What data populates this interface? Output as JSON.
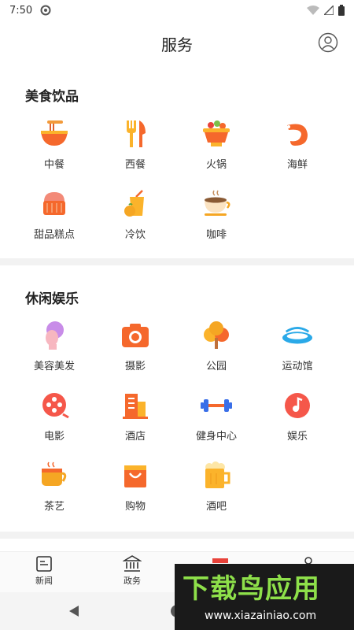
{
  "status": {
    "time": "7:50"
  },
  "header": {
    "title": "服务"
  },
  "sections": [
    {
      "title": "美食饮品",
      "items": [
        {
          "label": "中餐",
          "icon": "noodle-bowl-icon"
        },
        {
          "label": "西餐",
          "icon": "fork-knife-icon"
        },
        {
          "label": "火锅",
          "icon": "hotpot-icon"
        },
        {
          "label": "海鲜",
          "icon": "shrimp-icon"
        },
        {
          "label": "甜品糕点",
          "icon": "cake-icon"
        },
        {
          "label": "冷饮",
          "icon": "cold-drink-icon"
        },
        {
          "label": "咖啡",
          "icon": "coffee-icon"
        }
      ]
    },
    {
      "title": "休闲娱乐",
      "items": [
        {
          "label": "美容美发",
          "icon": "beauty-icon"
        },
        {
          "label": "摄影",
          "icon": "camera-icon"
        },
        {
          "label": "公园",
          "icon": "tree-icon"
        },
        {
          "label": "运动馆",
          "icon": "stadium-icon"
        },
        {
          "label": "电影",
          "icon": "film-reel-icon"
        },
        {
          "label": "酒店",
          "icon": "hotel-building-icon"
        },
        {
          "label": "健身中心",
          "icon": "dumbbell-icon"
        },
        {
          "label": "娱乐",
          "icon": "music-note-icon"
        },
        {
          "label": "茶艺",
          "icon": "tea-cup-icon"
        },
        {
          "label": "购物",
          "icon": "shopping-bag-icon"
        },
        {
          "label": "酒吧",
          "icon": "beer-mug-icon"
        }
      ]
    }
  ],
  "tabbar": [
    {
      "label": "新闻",
      "icon": "news-icon"
    },
    {
      "label": "政务",
      "icon": "government-icon"
    }
  ],
  "watermark": {
    "logo": "下载鸟应用",
    "url": "www.xiazainiao.com"
  },
  "colors": {
    "accent_orange": "#f5682c",
    "accent_yellow": "#fbb32b",
    "blue": "#3a6fe8",
    "divider": "#f2f2f2"
  }
}
